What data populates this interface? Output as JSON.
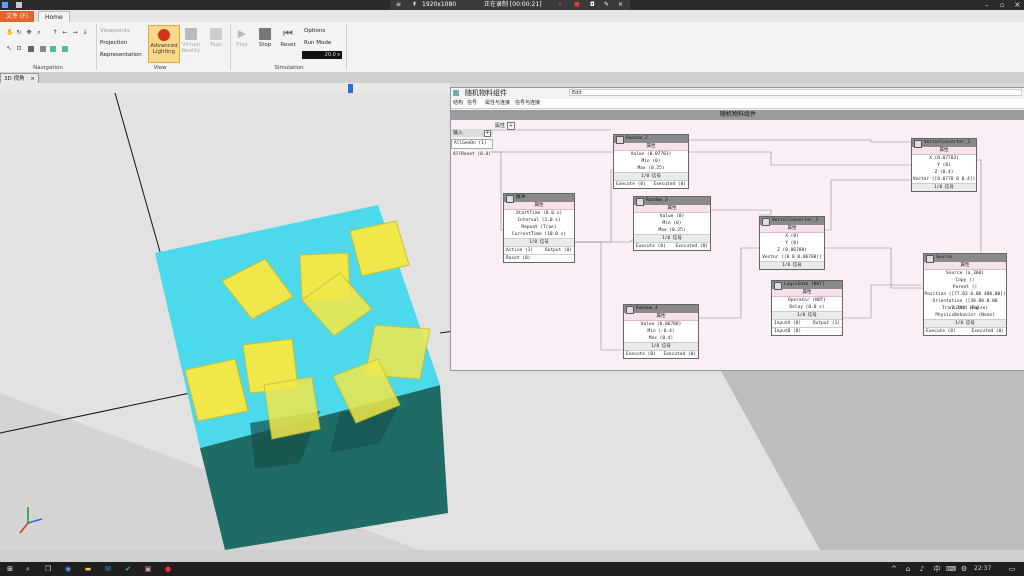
{
  "recorder": {
    "resolution": "1920x1080",
    "status": "正在录制 [00:00:21]"
  },
  "ribbon": {
    "tabs": [
      "文件 (F)",
      "Home"
    ],
    "groups": {
      "navigation": "Navigation",
      "view": "View",
      "simulation": "Simulation"
    },
    "view_items": {
      "viewpoints": "Viewpoints",
      "projection": "Projection",
      "representation": "Representation",
      "advanced_lighting": "Advanced Lighting",
      "virtual_reality": "Virtual Reality",
      "tags": "Tags"
    },
    "sim_items": {
      "play": "Play",
      "stop": "Stop",
      "reset": "Reset",
      "options": "Options",
      "run_mode": "Run Mode",
      "timer": "20.0 s"
    }
  },
  "document_tab": "3D 视角",
  "graph": {
    "title": "随机物料组件",
    "menu": [
      "结构",
      "信号",
      "属性与连接",
      "信号与连接"
    ],
    "search_value": "Edit",
    "header": "随机物料组件",
    "properties_label": "属性",
    "inputs_panel": {
      "title": "输入",
      "items": [
        "AllGenOn (1)",
        "AllReset (0.4)"
      ]
    },
    "nodes": [
      {
        "title": "Random_2",
        "section": "属性",
        "rows": [
          "Value (0.07783)",
          "Min (0)",
          "Max (0.25)"
        ],
        "count": "1/0 信号",
        "footer_left": "Execute (0)",
        "footer_right": "Executed (0)"
      },
      {
        "title": "Random_3",
        "section": "属性",
        "rows": [
          "Value (0)",
          "Min (0)",
          "Max (0.25)"
        ],
        "count": "1/0 信号",
        "footer_left": "Execute (0)",
        "footer_right": "Executed (0)"
      },
      {
        "title": "Random_4",
        "section": "属性",
        "rows": [
          "Value (0.06788)",
          "Min (-0.4)",
          "Max (0.4)"
        ],
        "count": "1/0 信号",
        "footer_left": "Execute (0)",
        "footer_right": "Executed (0)"
      },
      {
        "title": "脉冲",
        "section": "属性",
        "rows": [
          "StartTime (0.0 s)",
          "Interval (2.0 s)",
          "Repeat (True)",
          "CurrentTime (10.0 s)"
        ],
        "count": "1/0 信号",
        "footer_left": "Active (1)",
        "footer_right": "Output (0)",
        "extra": "Reset (0)"
      },
      {
        "title": "VectorConverter_2",
        "section": "属性",
        "rows": [
          "X (0.07783)",
          "Y (0)",
          "Z (0.4)",
          "Vector ([0.0778 0 0.4])"
        ],
        "count": "1/0 信号"
      },
      {
        "title": "VectorConverter_3",
        "section": "属性",
        "rows": [
          "X (0)",
          "Y (0)",
          "Z (0.06788)",
          "Vector ([0 0 0.06788])"
        ],
        "count": "1/0 信号"
      },
      {
        "title": "LogicGate [NOT]",
        "section": "属性",
        "rows": [
          "Operator (NOT)",
          "Delay (0.0 s)"
        ],
        "count": "1/0 信号",
        "footer_left": "InputA (0)",
        "footer_right": "Output (1)",
        "extra": "InputB (0)"
      },
      {
        "title": "Source",
        "section": "属性",
        "rows": [
          "Source (a_360)",
          "Copy ()",
          "Parent ()",
          "Position ([77.83 0.00 400.00])",
          "Orientation ([30.00 0.00 7.79]) deg",
          "Transient (False)",
          "PhysicsBehavior (None)"
        ],
        "count": "1/0 信号",
        "footer_left": "Execute (0)",
        "footer_right": "Executed (0)"
      }
    ]
  },
  "taskbar": {
    "ime": "中",
    "time": "22:37"
  },
  "colors": {
    "cube_top": "#4dd9ec",
    "cube_side": "#1f6b66",
    "cards": "#f0e84a",
    "graph_bg": "#fbeff7",
    "node_header": "#8a8a8a",
    "orange_tab": "#e8632b"
  }
}
